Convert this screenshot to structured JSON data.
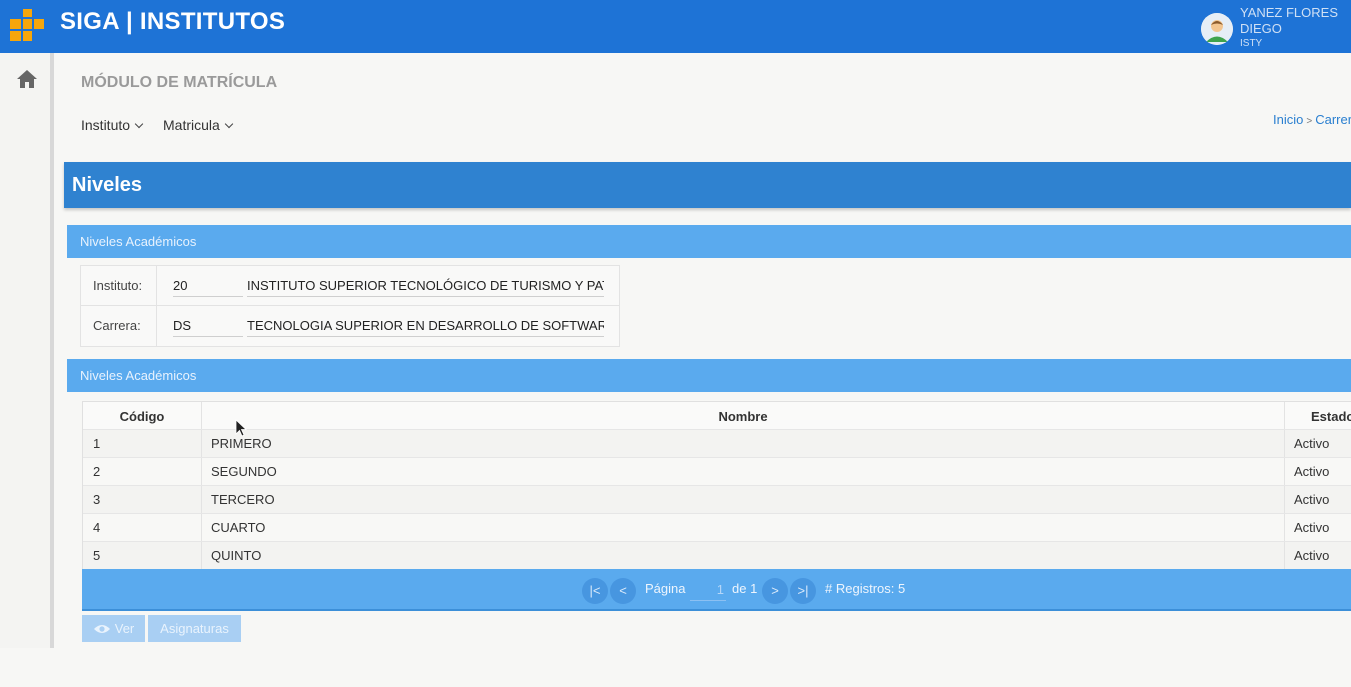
{
  "app": {
    "title": "SIGA | INSTITUTOS"
  },
  "user": {
    "name": "YANEZ FLORES DIEGO ALEXANDER",
    "institute": "ISTY"
  },
  "sidebar": {
    "home_icon": "home-icon"
  },
  "module": {
    "title": "MÓDULO DE MATRÍCULA"
  },
  "menu": {
    "items": [
      {
        "label": "Instituto"
      },
      {
        "label": "Matricula"
      }
    ]
  },
  "breadcrumb": {
    "items": [
      "Inicio",
      "Carrera"
    ]
  },
  "page": {
    "title": "Niveles"
  },
  "section1": {
    "title": "Niveles Académicos"
  },
  "form": {
    "instituto": {
      "label": "Instituto:",
      "code": "20",
      "name": "INSTITUTO SUPERIOR TECNOLÓGICO DE TURISMO Y PATRIMO"
    },
    "carrera": {
      "label": "Carrera:",
      "code": "DS",
      "name": "TECNOLOGIA SUPERIOR EN DESARROLLO DE SOFTWARE"
    }
  },
  "section2": {
    "title": "Niveles Académicos"
  },
  "grid": {
    "headers": {
      "codigo": "Código",
      "nombre": "Nombre",
      "estado": "Estado"
    },
    "rows": [
      {
        "codigo": "1",
        "nombre": "PRIMERO",
        "estado": "Activo"
      },
      {
        "codigo": "2",
        "nombre": "SEGUNDO",
        "estado": "Activo"
      },
      {
        "codigo": "3",
        "nombre": "TERCERO",
        "estado": "Activo"
      },
      {
        "codigo": "4",
        "nombre": "CUARTO",
        "estado": "Activo"
      },
      {
        "codigo": "5",
        "nombre": "QUINTO",
        "estado": "Activo"
      }
    ]
  },
  "pager": {
    "page_label": "Página",
    "page_value": "1",
    "of_label": "de 1",
    "records_label": "# Registros: 5"
  },
  "actions": {
    "ver_label": "Ver",
    "asignaturas_label": "Asignaturas"
  },
  "colors": {
    "topbar": "#1e73d6",
    "panel_header": "#5aaaee",
    "page_header": "#2f82d0",
    "logo": "#f6a60b"
  }
}
